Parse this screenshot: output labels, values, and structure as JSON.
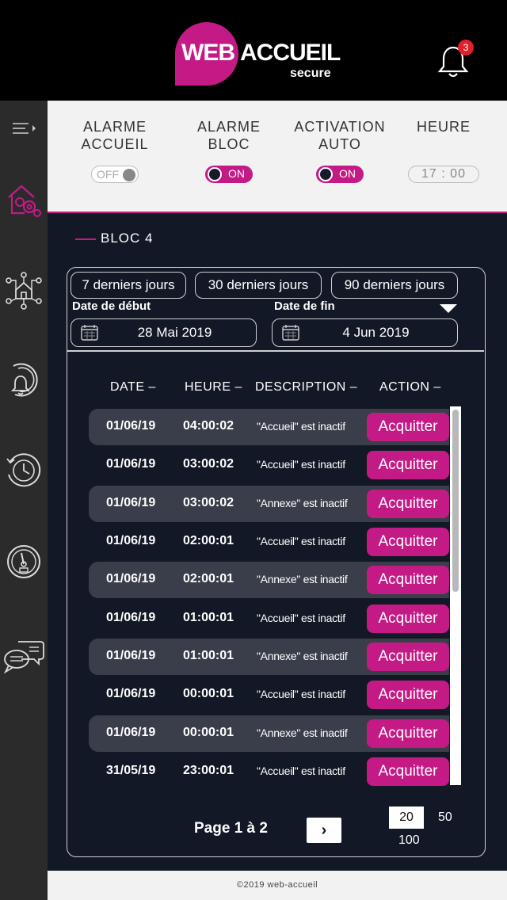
{
  "header": {
    "logo_web": "WEB",
    "logo_accueil": "ACCUEIL",
    "logo_secure": "secure",
    "notification_count": "3"
  },
  "sidebar": {
    "items": [
      {
        "icon": "menu-arrow-icon"
      },
      {
        "icon": "house-gears-icon"
      },
      {
        "icon": "network-house-icon"
      },
      {
        "icon": "alarm-history-icon"
      },
      {
        "icon": "clock-history-icon"
      },
      {
        "icon": "gauge-icon"
      },
      {
        "icon": "chat-bubbles-icon"
      }
    ]
  },
  "toggles": [
    {
      "label": "ALARME ACCUEIL",
      "state": "OFF"
    },
    {
      "label": "ALARME BLOC",
      "state": "ON"
    },
    {
      "label": "ACTIVATION AUTO",
      "state": "ON"
    },
    {
      "label": "HEURE",
      "value": "17 : 00"
    }
  ],
  "bloc": {
    "title": "BLOC 4"
  },
  "filters": {
    "ranges": [
      "7 derniers jours",
      "30 derniers jours",
      "90 derniers jours"
    ],
    "start_label": "Date de début",
    "end_label": "Date de fin",
    "start_value": "28 Mai 2019",
    "end_value": "4 Jun 2019"
  },
  "table": {
    "headers": [
      "DATE –",
      "HEURE –",
      "DESCRIPTION –",
      "ACTION –"
    ],
    "action_label": "Acquitter",
    "rows": [
      {
        "date": "01/06/19",
        "time": "04:00:02",
        "desc": "\"Accueil\" est inactif"
      },
      {
        "date": "01/06/19",
        "time": "03:00:02",
        "desc": "\"Accueil\" est inactif"
      },
      {
        "date": "01/06/19",
        "time": "03:00:02",
        "desc": "\"Annexe\" est inactif"
      },
      {
        "date": "01/06/19",
        "time": "02:00:01",
        "desc": "\"Accueil\" est inactif"
      },
      {
        "date": "01/06/19",
        "time": "02:00:01",
        "desc": "\"Annexe\" est inactif"
      },
      {
        "date": "01/06/19",
        "time": "01:00:01",
        "desc": "\"Accueil\" est inactif"
      },
      {
        "date": "01/06/19",
        "time": "01:00:01",
        "desc": "\"Annexe\" est inactif"
      },
      {
        "date": "01/06/19",
        "time": "00:00:01",
        "desc": "\"Accueil\" est inactif"
      },
      {
        "date": "01/06/19",
        "time": "00:00:01",
        "desc": "\"Annexe\" est inactif"
      },
      {
        "date": "31/05/19",
        "time": "23:00:01",
        "desc": "\"Accueil\" est inactif"
      }
    ]
  },
  "pagination": {
    "info": "Page 1 à 2",
    "next": "›",
    "sizes": [
      "20",
      "50",
      "100"
    ],
    "selected": "20"
  },
  "footer": {
    "text": "©2019 web-accueil"
  },
  "colors": {
    "accent": "#c41a86",
    "panel_bg": "#131826",
    "sidebar_bg": "#2b2b2b"
  }
}
